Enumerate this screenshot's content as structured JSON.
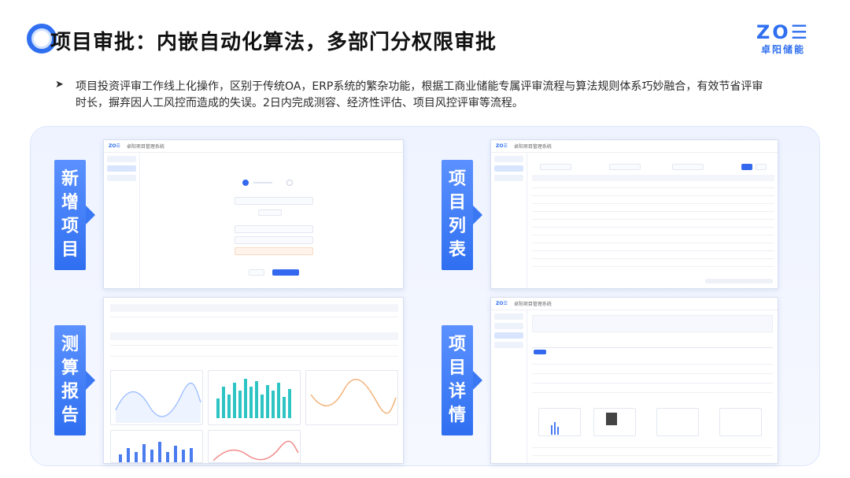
{
  "header": {
    "title": "项目审批：内嵌自动化算法，多部门分权限审批",
    "brand_mark": "ZO☰",
    "brand_name": "卓阳储能"
  },
  "bullet": {
    "mark": "➤",
    "text": "项目投资评审工作线上化操作，区别于传统OA，ERP系统的繁杂功能，根据工商业储能专属评审流程与算法规则体系巧妙融合，有效节省评审时长，摒弃因人工风控而造成的失误。2日内完成测容、经济性评估、项目风控评审等流程。"
  },
  "labels": {
    "new_project": [
      "新",
      "增",
      "项",
      "目"
    ],
    "project_list": [
      "项",
      "目",
      "列",
      "表"
    ],
    "report": [
      "测",
      "算",
      "报",
      "告"
    ],
    "detail": [
      "项",
      "目",
      "详",
      "情"
    ]
  },
  "screens": {
    "app_logo": "ZO☰",
    "app_name": "卓阳项目管理系统"
  },
  "colors": {
    "accent": "#2f6ff0",
    "label_bg": "#3a78f3",
    "chart_teal": "#2ec4c4",
    "chart_blue": "#4a7cf0",
    "chart_orange": "#f2b37a",
    "chart_red": "#f28a8a"
  }
}
